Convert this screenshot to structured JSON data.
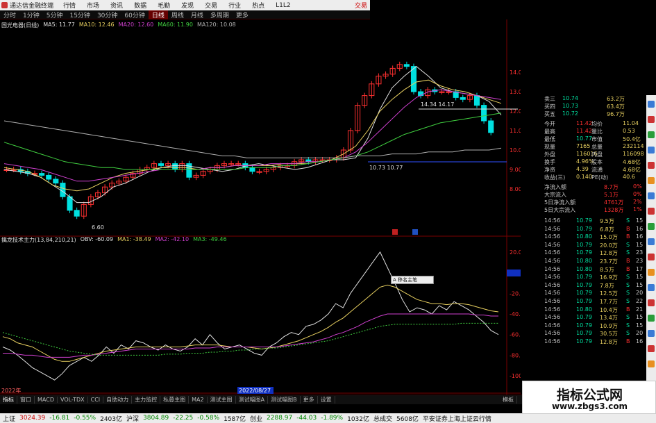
{
  "app": {
    "title": "通达信金融终端",
    "menu": [
      "行情",
      "市场",
      "资讯",
      "数据",
      "毛勤",
      "发现",
      "交易",
      "行业",
      "热点",
      "L1L2"
    ],
    "trade_label": "交易"
  },
  "periods": {
    "items": [
      "分时",
      "1分钟",
      "5分钟",
      "15分钟",
      "30分钟",
      "60分钟",
      "日线",
      "周线",
      "月线",
      "多周期",
      "更多"
    ],
    "active_index": 6
  },
  "main_legend": {
    "name": "国光电器(日线)",
    "items": [
      {
        "label": "MA5: 11.77",
        "color": "#e0e0e0"
      },
      {
        "label": "MA10: 12.46",
        "color": "#e8d060"
      },
      {
        "label": "MA20: 12.60",
        "color": "#d040d0"
      },
      {
        "label": "MA60: 11.90",
        "color": "#40d040"
      },
      {
        "label": "MA120: 10.08",
        "color": "#b0b0b0"
      }
    ]
  },
  "sub_legend": {
    "name": "擒龙技术主力(13,84,210,21)",
    "items": [
      {
        "label": "OBV: -60.09",
        "color": "#e0e0e0"
      },
      {
        "label": "MA1: -38.49",
        "color": "#e8d060"
      },
      {
        "label": "MA2: -42.10",
        "color": "#d040d0"
      },
      {
        "label": "MA3: -49.46",
        "color": "#40d040"
      }
    ]
  },
  "chart_annotations": {
    "high_label": "14.34 14.17",
    "mid_label": "10.73 10.77",
    "low_label": "6.60",
    "date_label": "2022/08/27",
    "year_label": "2022年",
    "popup": "A 移名主笔"
  },
  "price_axis": [
    "14.00",
    "13.00",
    "12.00",
    "11.00",
    "10.00",
    "9.00",
    "8.00"
  ],
  "sub_axis": [
    "20.00",
    "-0.98",
    "-20.00",
    "-40.00",
    "-60.00",
    "-80.00",
    "-100.00"
  ],
  "quote_panel": {
    "levels": [
      {
        "label": "卖三",
        "price": "10.74",
        "vol": "63.2万"
      },
      {
        "label": "买四",
        "price": "10.73",
        "vol": "63.4万"
      },
      {
        "label": "买五",
        "price": "10.72",
        "vol": "96.7万"
      }
    ],
    "stats": [
      {
        "l1": "今开",
        "v1": "11.42",
        "l2": "均价",
        "v2": "11.04"
      },
      {
        "l1": "最高",
        "v1": "11.42",
        "l2": "量比",
        "v2": "0.53"
      },
      {
        "l1": "最低",
        "v1": "10.77",
        "l2": "市值",
        "v2": "50.4亿"
      },
      {
        "l1": "现量",
        "v1": "7165",
        "l2": "总量",
        "v2": "232114"
      },
      {
        "l1": "外盘",
        "v1": "116016",
        "l2": "内盘",
        "v2": "116098"
      },
      {
        "l1": "换手",
        "v1": "4.96%",
        "l2": "股本",
        "v2": "4.68亿"
      },
      {
        "l1": "净资",
        "v1": "4.39",
        "l2": "流通",
        "v2": "4.68亿"
      },
      {
        "l1": "收益(三)",
        "v1": "0.140",
        "l2": "PE(动)",
        "v2": "40.6"
      }
    ],
    "flows": [
      {
        "label": "净流入额",
        "value": "8.7万",
        "pct": "0%"
      },
      {
        "label": "大宗流入",
        "value": "5.1万",
        "pct": "0%"
      },
      {
        "label": "5日净流入额",
        "value": "4761万",
        "pct": "2%"
      },
      {
        "label": "5日大宗流入",
        "value": "1328万",
        "pct": "1%"
      }
    ],
    "ticks": [
      {
        "time": "14:56",
        "price": "10.79",
        "vol": "9.5万",
        "side": "S",
        "n": "15"
      },
      {
        "time": "14:56",
        "price": "10.79",
        "vol": "6.8万",
        "side": "B",
        "n": "16"
      },
      {
        "time": "14:56",
        "price": "10.80",
        "vol": "15.0万",
        "side": "B",
        "n": "16"
      },
      {
        "time": "14:56",
        "price": "10.79",
        "vol": "20.0万",
        "side": "S",
        "n": "15"
      },
      {
        "time": "14:56",
        "price": "10.79",
        "vol": "12.8万",
        "side": "S",
        "n": "23"
      },
      {
        "time": "14:56",
        "price": "10.80",
        "vol": "23.7万",
        "side": "B",
        "n": "23"
      },
      {
        "time": "14:56",
        "price": "10.80",
        "vol": "8.5万",
        "side": "B",
        "n": "17"
      },
      {
        "time": "14:56",
        "price": "10.79",
        "vol": "16.9万",
        "side": "S",
        "n": "15"
      },
      {
        "time": "14:56",
        "price": "10.79",
        "vol": "7.8万",
        "side": "S",
        "n": "15"
      },
      {
        "time": "14:56",
        "price": "10.79",
        "vol": "12.5万",
        "side": "S",
        "n": "20"
      },
      {
        "time": "14:56",
        "price": "10.79",
        "vol": "17.7万",
        "side": "S",
        "n": "22"
      },
      {
        "time": "14:56",
        "price": "10.80",
        "vol": "10.4万",
        "side": "B",
        "n": "21"
      },
      {
        "time": "14:56",
        "price": "10.79",
        "vol": "13.4万",
        "side": "S",
        "n": "15"
      },
      {
        "time": "14:56",
        "price": "10.79",
        "vol": "10.9万",
        "side": "S",
        "n": "15"
      },
      {
        "time": "14:56",
        "price": "10.79",
        "vol": "30.5万",
        "side": "S",
        "n": "20"
      },
      {
        "time": "14:56",
        "price": "10.79",
        "vol": "12.8万",
        "side": "B",
        "n": "16"
      }
    ]
  },
  "bottom_tabs": {
    "items": [
      "指标",
      "窗口",
      "MACD",
      "VOL-TDX",
      "CCI",
      "自助动力",
      "主力监控",
      "私募主图",
      "MA2",
      "测试主图",
      "测试幅图A",
      "测试幅图B",
      "更多",
      "设置"
    ],
    "active_index": 0,
    "right_label": "模板"
  },
  "statusbar": {
    "items": [
      {
        "label": "上证",
        "value": "3024.39",
        "chg": "-16.81",
        "pct": "-0.55%",
        "amt": "2403亿"
      },
      {
        "label": "沪深",
        "value": "3804.89",
        "chg": "-22.25",
        "pct": "-0.58%",
        "amt": "1587亿"
      },
      {
        "label": "创业",
        "value": "2288.97",
        "chg": "-44.03",
        "pct": "-1.89%",
        "amt": "1032亿"
      }
    ],
    "total_label": "总成交",
    "total_value": "5608亿",
    "broker": "平安证券上海上证云行情"
  },
  "watermark": {
    "cn": "指标公式网",
    "url": "www.zbgs3.com"
  },
  "colors": {
    "up": "#ff3030",
    "down": "#00e0e0",
    "grid": "#7a0000",
    "price": "#ffffff",
    "volume": "#e8d060"
  },
  "chart_data": [
    {
      "type": "candlestick",
      "title": "国光电器(日线)",
      "ylim": [
        6.0,
        15.0
      ],
      "y_ticks": [
        8,
        9,
        10,
        11,
        12,
        13,
        14
      ],
      "close": [
        9.0,
        9.0,
        8.9,
        8.8,
        8.8,
        8.7,
        8.5,
        8.3,
        7.6,
        6.9,
        6.6,
        7.2,
        7.6,
        7.8,
        8.1,
        8.3,
        8.4,
        8.6,
        8.8,
        9.0,
        9.1,
        9.3,
        9.2,
        9.3,
        9.0,
        9.3,
        8.6,
        8.7,
        8.9,
        9.0,
        9.2,
        9.3,
        9.3,
        9.3,
        9.1,
        8.9,
        8.9,
        9.0,
        9.1,
        9.2,
        9.2,
        9.4,
        9.5,
        9.4,
        9.5,
        9.5,
        9.5,
        9.6,
        10.0,
        11.0,
        12.3,
        12.8,
        13.4,
        13.8,
        13.9,
        14.2,
        14.4,
        14.3,
        13.0,
        12.8,
        13.1,
        13.0,
        13.0,
        13.0,
        12.7,
        12.6,
        12.8,
        12.3,
        11.5,
        10.9
      ],
      "series": [
        {
          "name": "MA5",
          "values": [
            9.0,
            8.9,
            8.8,
            8.6,
            8.2,
            7.8,
            7.3,
            7.3,
            7.6,
            8.1,
            8.3,
            8.6,
            8.9,
            9.1,
            9.2,
            9.2,
            9.1,
            9.0,
            8.9,
            9.0,
            9.2,
            9.3,
            9.2,
            9.1,
            9.0,
            9.1,
            9.3,
            9.5,
            9.5,
            9.6,
            10.6,
            12.1,
            13.2,
            13.8,
            14.3,
            13.8,
            13.2,
            13.0,
            12.9,
            12.8,
            12.5,
            11.8
          ]
        },
        {
          "name": "MA10",
          "values": [
            9.1,
            9.0,
            8.9,
            8.6,
            8.2,
            8.0,
            7.9,
            8.0,
            8.3,
            8.6,
            8.8,
            8.9,
            9.0,
            9.1,
            9.1,
            9.1,
            9.0,
            9.1,
            9.1,
            9.2,
            9.2,
            9.2,
            9.2,
            9.3,
            9.3,
            9.3,
            9.4,
            9.5,
            9.8,
            10.2,
            11.0,
            12.0,
            12.6,
            13.1,
            13.5,
            13.6,
            13.3,
            13.1,
            13.0,
            12.8,
            12.6,
            12.4
          ]
        },
        {
          "name": "MA20",
          "values": [
            9.3,
            9.2,
            9.1,
            9.0,
            8.8,
            8.6,
            8.4,
            8.4,
            8.5,
            8.6,
            8.7,
            8.8,
            8.9,
            9.0,
            9.0,
            9.0,
            9.0,
            9.1,
            9.1,
            9.2,
            9.2,
            9.2,
            9.3,
            9.3,
            9.3,
            9.4,
            9.4,
            9.5,
            9.6,
            9.9,
            10.4,
            11.0,
            11.6,
            12.2,
            12.7,
            13.0,
            13.1,
            13.0,
            12.9,
            12.8,
            12.7,
            12.6
          ]
        },
        {
          "name": "MA60",
          "values": [
            10.4,
            10.2,
            10.0,
            9.8,
            9.6,
            9.4,
            9.3,
            9.2,
            9.1,
            9.1,
            9.0,
            9.0,
            9.0,
            9.0,
            9.0,
            9.0,
            9.0,
            9.0,
            9.0,
            9.0,
            9.1,
            9.1,
            9.1,
            9.2,
            9.2,
            9.3,
            9.4,
            9.5,
            9.6,
            9.7,
            9.9,
            10.2,
            10.5,
            10.8,
            11.0,
            11.2,
            11.4,
            11.5,
            11.6,
            11.7,
            11.8,
            11.9
          ]
        },
        {
          "name": "MA120",
          "values": [
            11.5,
            11.4,
            11.3,
            11.2,
            11.1,
            11.0,
            10.9,
            10.8,
            10.7,
            10.6,
            10.5,
            10.4,
            10.3,
            10.2,
            10.1,
            10.0,
            9.9,
            9.8,
            9.7,
            9.7,
            9.6,
            9.6,
            9.6,
            9.6,
            9.6,
            9.6,
            9.6,
            9.6,
            9.6,
            9.7,
            9.7,
            9.7,
            9.8,
            9.8,
            9.8,
            9.9,
            9.9,
            9.9,
            10.0,
            10.0,
            10.0,
            10.1
          ]
        }
      ]
    },
    {
      "type": "line",
      "title": "擒龙技术主力(13,84,210,21)",
      "ylim": [
        -110,
        30
      ],
      "y_ticks": [
        20,
        -20,
        -40,
        -60,
        -80,
        -100
      ],
      "series": [
        {
          "name": "OBV",
          "values": [
            -72,
            -75,
            -80,
            -86,
            -92,
            -96,
            -100,
            -104,
            -98,
            -90,
            -86,
            -82,
            -86,
            -80,
            -72,
            -78,
            -70,
            -74,
            -66,
            -68,
            -72,
            -75,
            -70,
            -74,
            -76,
            -72,
            -64,
            -70,
            -60,
            -68,
            -74,
            -72,
            -70,
            -74,
            -78,
            -80,
            -72,
            -68,
            -62,
            -58,
            -60,
            -52,
            -50,
            -46,
            -40,
            -30,
            -34,
            -20,
            -10,
            0,
            10,
            20,
            5,
            -10,
            -26,
            -38,
            -34,
            -36,
            -40,
            -32,
            -36,
            -28,
            -32,
            -36,
            -42,
            -48,
            -56,
            -60
          ]
        },
        {
          "name": "MA1",
          "values": [
            -62,
            -64,
            -68,
            -70,
            -72,
            -76,
            -80,
            -84,
            -86,
            -86,
            -84,
            -82,
            -80,
            -78,
            -76,
            -75,
            -74,
            -73,
            -72,
            -72,
            -72,
            -72,
            -72,
            -72,
            -72,
            -71,
            -70,
            -70,
            -70,
            -70,
            -71,
            -72,
            -72,
            -72,
            -73,
            -74,
            -73,
            -72,
            -70,
            -68,
            -66,
            -63,
            -60,
            -57,
            -53,
            -48,
            -44,
            -38,
            -32,
            -26,
            -20,
            -14,
            -12,
            -14,
            -18,
            -22,
            -26,
            -28,
            -30,
            -30,
            -31,
            -30,
            -30,
            -31,
            -33,
            -35,
            -37,
            -38
          ]
        },
        {
          "name": "MA2",
          "values": [
            -78,
            -78,
            -79,
            -80,
            -80,
            -81,
            -82,
            -82,
            -82,
            -82,
            -81,
            -80,
            -80,
            -79,
            -78,
            -77,
            -76,
            -75,
            -74,
            -74,
            -74,
            -74,
            -74,
            -74,
            -74,
            -74,
            -73,
            -73,
            -73,
            -72,
            -72,
            -72,
            -72,
            -72,
            -72,
            -72,
            -72,
            -72,
            -71,
            -70,
            -69,
            -68,
            -67,
            -65,
            -63,
            -60,
            -58,
            -55,
            -52,
            -48,
            -45,
            -42,
            -40,
            -40,
            -40,
            -40,
            -40,
            -40,
            -40,
            -40,
            -40,
            -40,
            -40,
            -40,
            -41,
            -41,
            -42,
            -42
          ]
        },
        {
          "name": "MA3",
          "values": [
            -58,
            -60,
            -62,
            -64,
            -66,
            -68,
            -70,
            -72,
            -74,
            -76,
            -77,
            -78,
            -79,
            -80,
            -80,
            -80,
            -80,
            -80,
            -80,
            -80,
            -80,
            -80,
            -79,
            -79,
            -79,
            -78,
            -78,
            -78,
            -77,
            -77,
            -76,
            -76,
            -75,
            -75,
            -74,
            -74,
            -73,
            -73,
            -72,
            -71,
            -70,
            -69,
            -68,
            -67,
            -66,
            -64,
            -62,
            -60,
            -58,
            -56,
            -54,
            -52,
            -51,
            -50,
            -50,
            -50,
            -50,
            -50,
            -50,
            -50,
            -50,
            -50,
            -49,
            -49,
            -49,
            -49,
            -49,
            -49
          ]
        }
      ]
    }
  ]
}
